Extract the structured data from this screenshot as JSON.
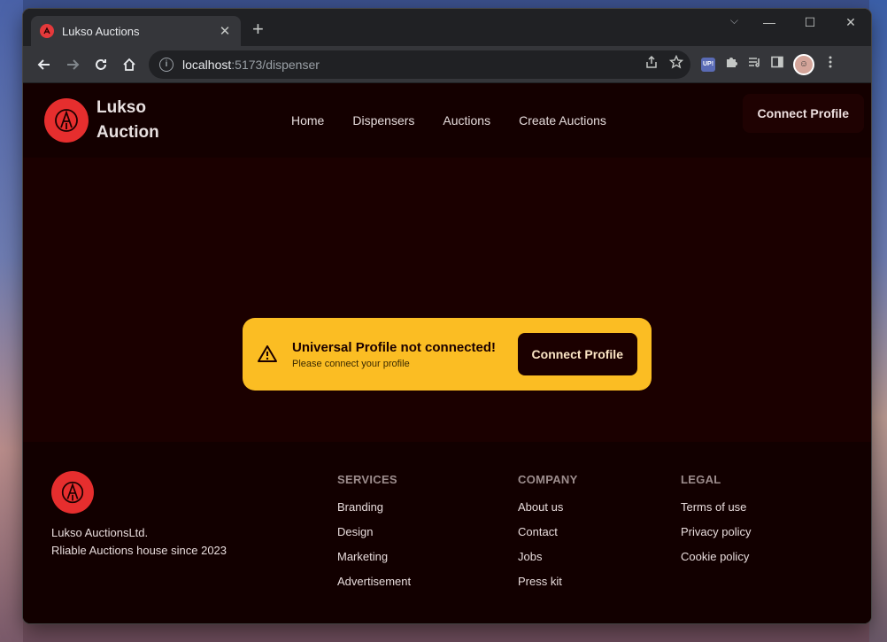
{
  "browser": {
    "tab_title": "Lukso Auctions",
    "new_tab_label": "+",
    "url_host": "localhost",
    "url_path": ":5173/dispenser",
    "ext_badge": "UP!"
  },
  "header": {
    "brand_line1": "Lukso",
    "brand_line2": "Auction",
    "nav": [
      "Home",
      "Dispensers",
      "Auctions",
      "Create Auctions"
    ],
    "connect_label": "Connect Profile"
  },
  "alert": {
    "title": "Universal Profile not connected!",
    "subtitle": "Please connect your profile",
    "button_label": "Connect Profile"
  },
  "footer": {
    "company_line1": "Lukso AuctionsLtd.",
    "company_line2": "Rliable Auctions house since 2023",
    "columns": [
      {
        "title": "SERVICES",
        "links": [
          "Branding",
          "Design",
          "Marketing",
          "Advertisement"
        ]
      },
      {
        "title": "COMPANY",
        "links": [
          "About us",
          "Contact",
          "Jobs",
          "Press kit"
        ]
      },
      {
        "title": "LEGAL",
        "links": [
          "Terms of use",
          "Privacy policy",
          "Cookie policy"
        ]
      }
    ]
  },
  "colors": {
    "page_bg": "#1b0000",
    "accent": "#e62e2e",
    "alert_bg": "#fbbd23"
  }
}
